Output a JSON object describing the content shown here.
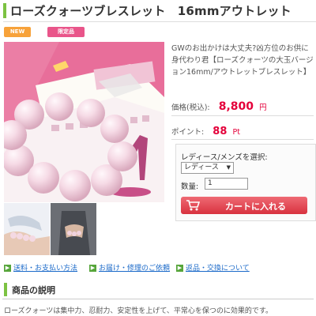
{
  "product": {
    "title": "ローズクォーツブレスレット　16mmアウトレット",
    "badges": {
      "new": "NEW",
      "limited": "限定品"
    },
    "description": "GWのお出かけは大丈夫?凶方位のお供に身代わり君【ローズクォーツの大玉バージョン16mm/アウトレットブレスレット】",
    "price": {
      "label": "価格(税込):",
      "value": "8,800",
      "unit": "円"
    },
    "points": {
      "label": "ポイント:",
      "value": "88",
      "unit": "Pt"
    }
  },
  "cart": {
    "size_label": "レディース/メンズを選択:",
    "size_selected": "レディース",
    "qty_label": "数量:",
    "qty_value": "1",
    "button_label": "カートに入れる"
  },
  "links": [
    {
      "label": "送料・お支払い方法"
    },
    {
      "label": "お届け・修理のご依頼"
    },
    {
      "label": "返品・交換について"
    }
  ],
  "section": {
    "title": "商品の説明",
    "body": "ローズクォーツは集中力、忍耐力、安定性を上げて、平常心を保つのに効果的です。"
  },
  "colors": {
    "accent_green": "#7cc242",
    "price_red": "#e4003a",
    "cart_button": "#d8323f",
    "link_blue": "#1b6ac9"
  },
  "icons": {
    "cart": "cart-icon",
    "link_arrow": "arrow-right-icon"
  }
}
